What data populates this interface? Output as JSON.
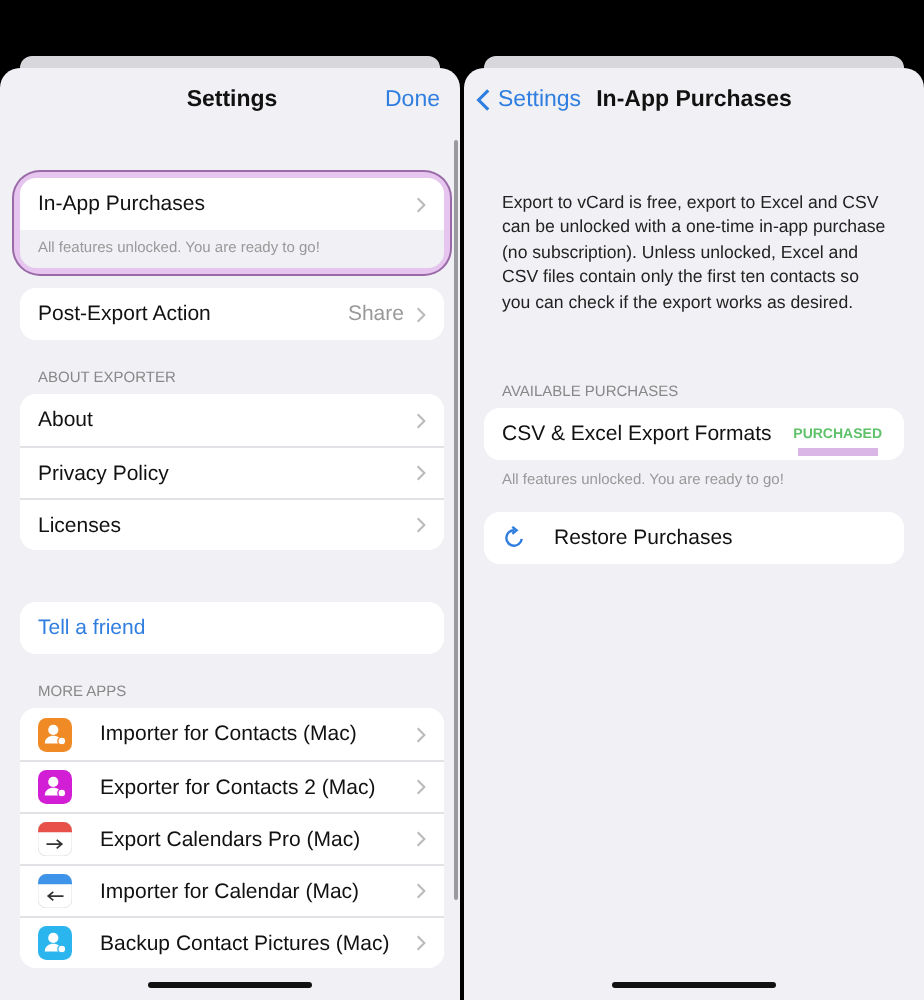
{
  "settings": {
    "title": "Settings",
    "done": "Done",
    "purchase_row": {
      "label": "In-App Purchases",
      "subtitle": "All features unlocked. You are ready to go!",
      "highlighted": true
    },
    "post_export": {
      "label": "Post-Export Action",
      "value": "Share"
    },
    "about_header": "ABOUT EXPORTER",
    "about_items": [
      "About",
      "Privacy Policy",
      "Licenses"
    ],
    "tell_friend": "Tell a friend",
    "apps_header": "MORE APPS",
    "apps": [
      {
        "label": "Importer for Contacts (Mac)",
        "kind": "contacts",
        "color": "#f08a24"
      },
      {
        "label": "Exporter for Contacts 2 (Mac)",
        "kind": "contacts",
        "color": "#d21fd6"
      },
      {
        "label": "Export Calendars Pro (Mac)",
        "kind": "calendar",
        "color": "#e8514a"
      },
      {
        "label": "Importer for Calendar (Mac)",
        "kind": "calendar",
        "color": "#3d94e8"
      },
      {
        "label": "Backup Contact Pictures (Mac)",
        "kind": "contacts",
        "color": "#2bb5ef"
      }
    ]
  },
  "purchases": {
    "back": "Settings",
    "title": "In-App Purchases",
    "description": "Export to vCard is free, export to Excel and CSV can be unlocked with a one-time in-app purchase (no subscription). Unless unlocked, Excel and CSV files contain only the first ten contacts so you can check if the export works as desired.",
    "header": "AVAILABLE PURCHASES",
    "item": {
      "label": "CSV & Excel Export Formats",
      "status": "PURCHASED",
      "highlighted": true
    },
    "note": "All features unlocked. You are ready to go!",
    "restore": "Restore Purchases"
  }
}
